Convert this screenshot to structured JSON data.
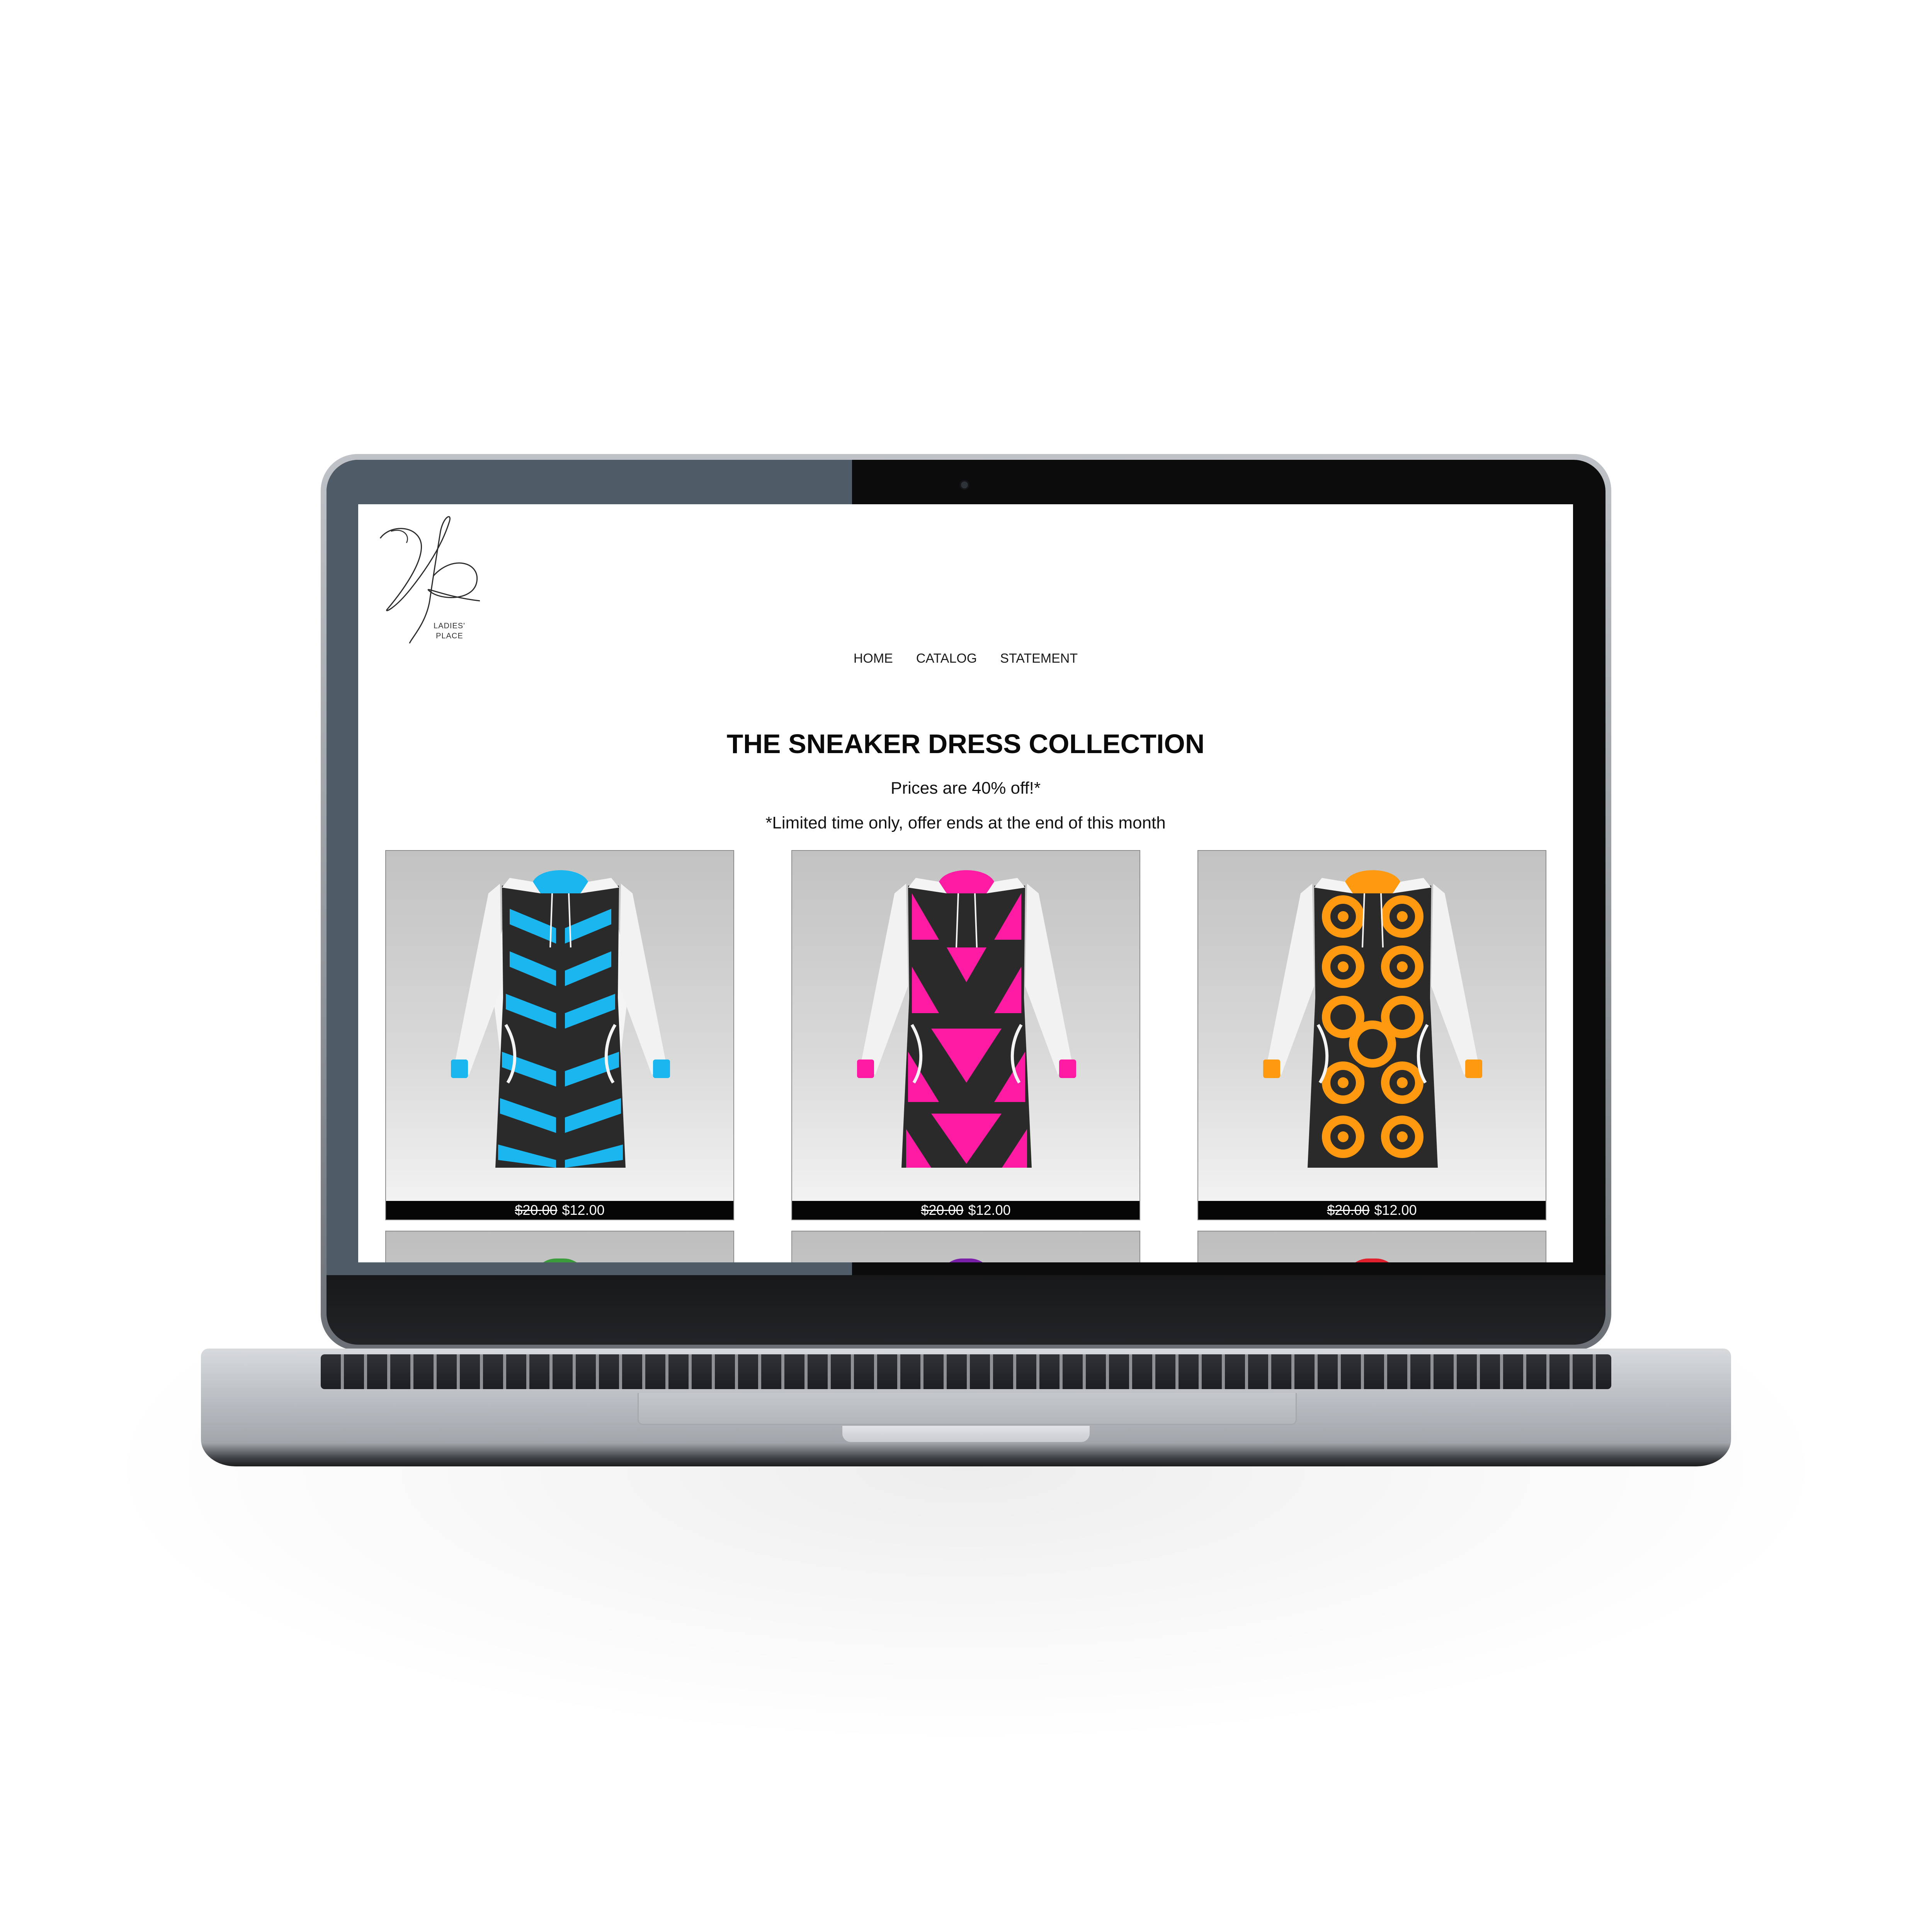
{
  "brand": {
    "logo_caption_line1": "LADIES'",
    "logo_caption_line2": "PLACE"
  },
  "nav": {
    "items": [
      {
        "label": "HOME"
      },
      {
        "label": "CATALOG"
      },
      {
        "label": "STATEMENT"
      }
    ]
  },
  "hero": {
    "title": "THE SNEAKER DRESS COLLECTION",
    "promo": "Prices are 40% off!*",
    "disclaimer": "*Limited time only, offer ends at the end of this month"
  },
  "products": [
    {
      "old_price": "$20.00",
      "price": "$12.00",
      "accent_color": "#1ab6ef",
      "pattern": "chevron"
    },
    {
      "old_price": "$20.00",
      "price": "$12.00",
      "accent_color": "#ff1aa3",
      "pattern": "triangle"
    },
    {
      "old_price": "$20.00",
      "price": "$12.00",
      "accent_color": "#ff9a10",
      "pattern": "circle-emblem"
    }
  ],
  "next_row": [
    {
      "accent_color": "#3a9c3a"
    },
    {
      "accent_color": "#7a1fa8"
    },
    {
      "accent_color": "#e0202c"
    }
  ],
  "colors": {
    "dress_body": "#2a2a2a",
    "sleeve": "#f4f4f4",
    "price_bar": "#050505"
  }
}
